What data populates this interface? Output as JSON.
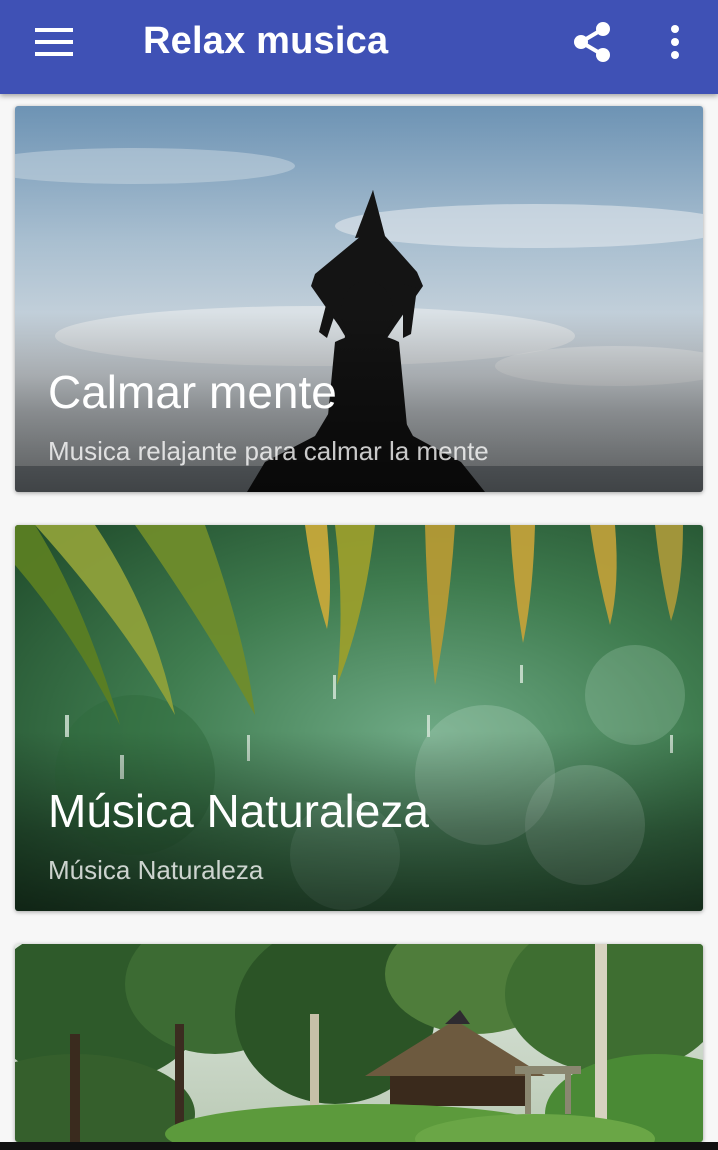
{
  "app_bar": {
    "title": "Relax musica",
    "menu_icon": "hamburger-menu-icon",
    "share_icon": "share-icon",
    "more_icon": "more-vert-icon",
    "color": "#3f51b5"
  },
  "cards": [
    {
      "title": "Calmar mente",
      "subtitle": "Musica relajante para calmar la mente",
      "image": "yoga-silhouette-sky"
    },
    {
      "title": "Música Naturaleza",
      "subtitle": "Música Naturaleza",
      "image": "bamboo-leaves-rain"
    },
    {
      "title": "",
      "subtitle": "",
      "image": "japanese-temple-forest"
    }
  ]
}
